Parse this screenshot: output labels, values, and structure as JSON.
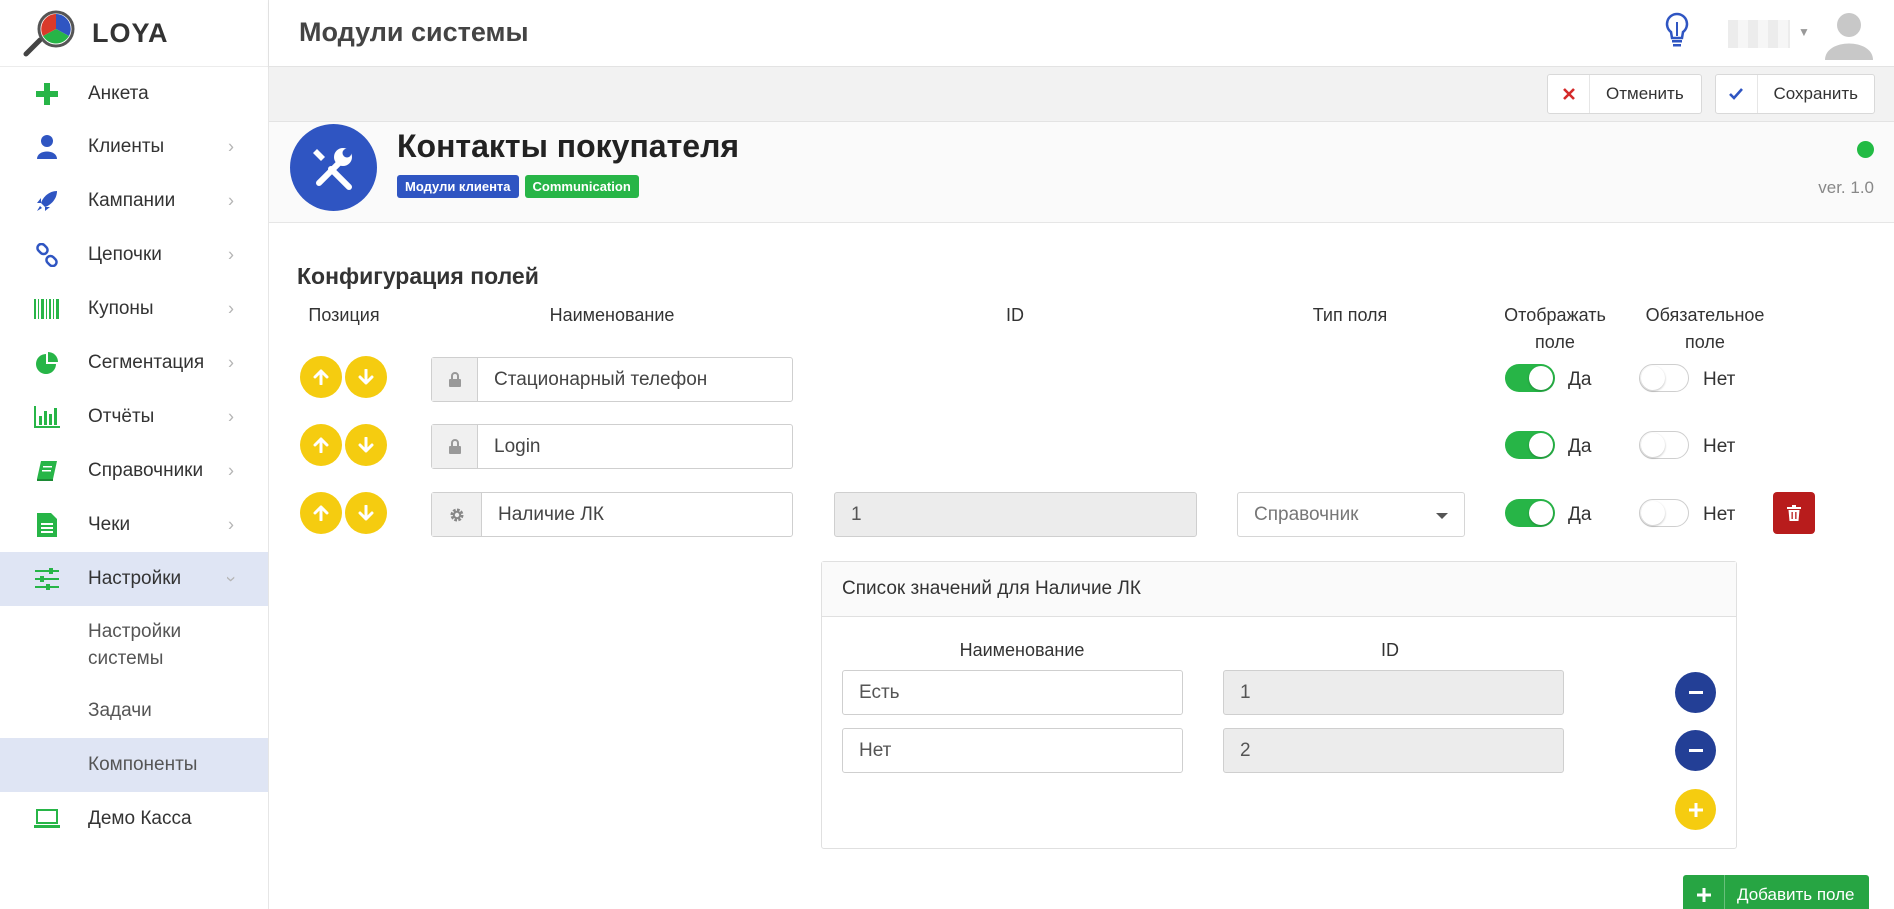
{
  "app": {
    "name": "LOYA"
  },
  "header": {
    "title": "Модули системы"
  },
  "sidebar": {
    "items": [
      {
        "label": "Анкета",
        "icon": "plus-icon"
      },
      {
        "label": "Клиенты",
        "icon": "user-icon"
      },
      {
        "label": "Кампании",
        "icon": "rocket-icon"
      },
      {
        "label": "Цепочки",
        "icon": "link-icon"
      },
      {
        "label": "Купоны",
        "icon": "barcode-icon"
      },
      {
        "label": "Сегментация",
        "icon": "pie-chart-icon"
      },
      {
        "label": "Отчёты",
        "icon": "bar-chart-icon"
      },
      {
        "label": "Справочники",
        "icon": "book-icon"
      },
      {
        "label": "Чеки",
        "icon": "receipt-icon"
      },
      {
        "label": "Настройки",
        "icon": "sliders-icon"
      }
    ],
    "subitems": [
      {
        "label": "Настройки системы"
      },
      {
        "label": "Задачи"
      },
      {
        "label": "Компоненты"
      }
    ],
    "last": {
      "label": "Демо Касса",
      "icon": "laptop-icon"
    }
  },
  "toolbar": {
    "cancel_label": "Отменить",
    "save_label": "Сохранить"
  },
  "module": {
    "title": "Контакты покупателя",
    "tags": [
      {
        "label": "Модули клиента",
        "color": "#2f55c2"
      },
      {
        "label": "Communication",
        "color": "#27b547"
      }
    ],
    "version": "ver. 1.0",
    "status_color": "#22bb44"
  },
  "config": {
    "title": "Конфигурация полей",
    "headers": {
      "position": "Позиция",
      "name": "Наименование",
      "id": "ID",
      "type": "Тип поля",
      "display": "Отображать поле",
      "required": "Обязательное поле"
    },
    "rows": [
      {
        "name": "Стационарный телефон",
        "display": "Да",
        "required": "Нет"
      },
      {
        "name": "Login",
        "display": "Да",
        "required": "Нет"
      },
      {
        "name": "Наличие ЛК",
        "id": "1",
        "type": "Справочник",
        "display": "Да",
        "required": "Нет"
      }
    ]
  },
  "values_panel": {
    "title": "Список значений для Наличие ЛК",
    "headers": {
      "name": "Наименование",
      "id": "ID"
    },
    "rows": [
      {
        "name": "Есть",
        "id": "1"
      },
      {
        "name": "Нет",
        "id": "2"
      }
    ]
  },
  "add_field_label": "Добавить поле",
  "colors": {
    "primary": "#2f55c2",
    "success": "#27b547",
    "warning": "#f5cc10",
    "danger": "#b81c1c"
  }
}
